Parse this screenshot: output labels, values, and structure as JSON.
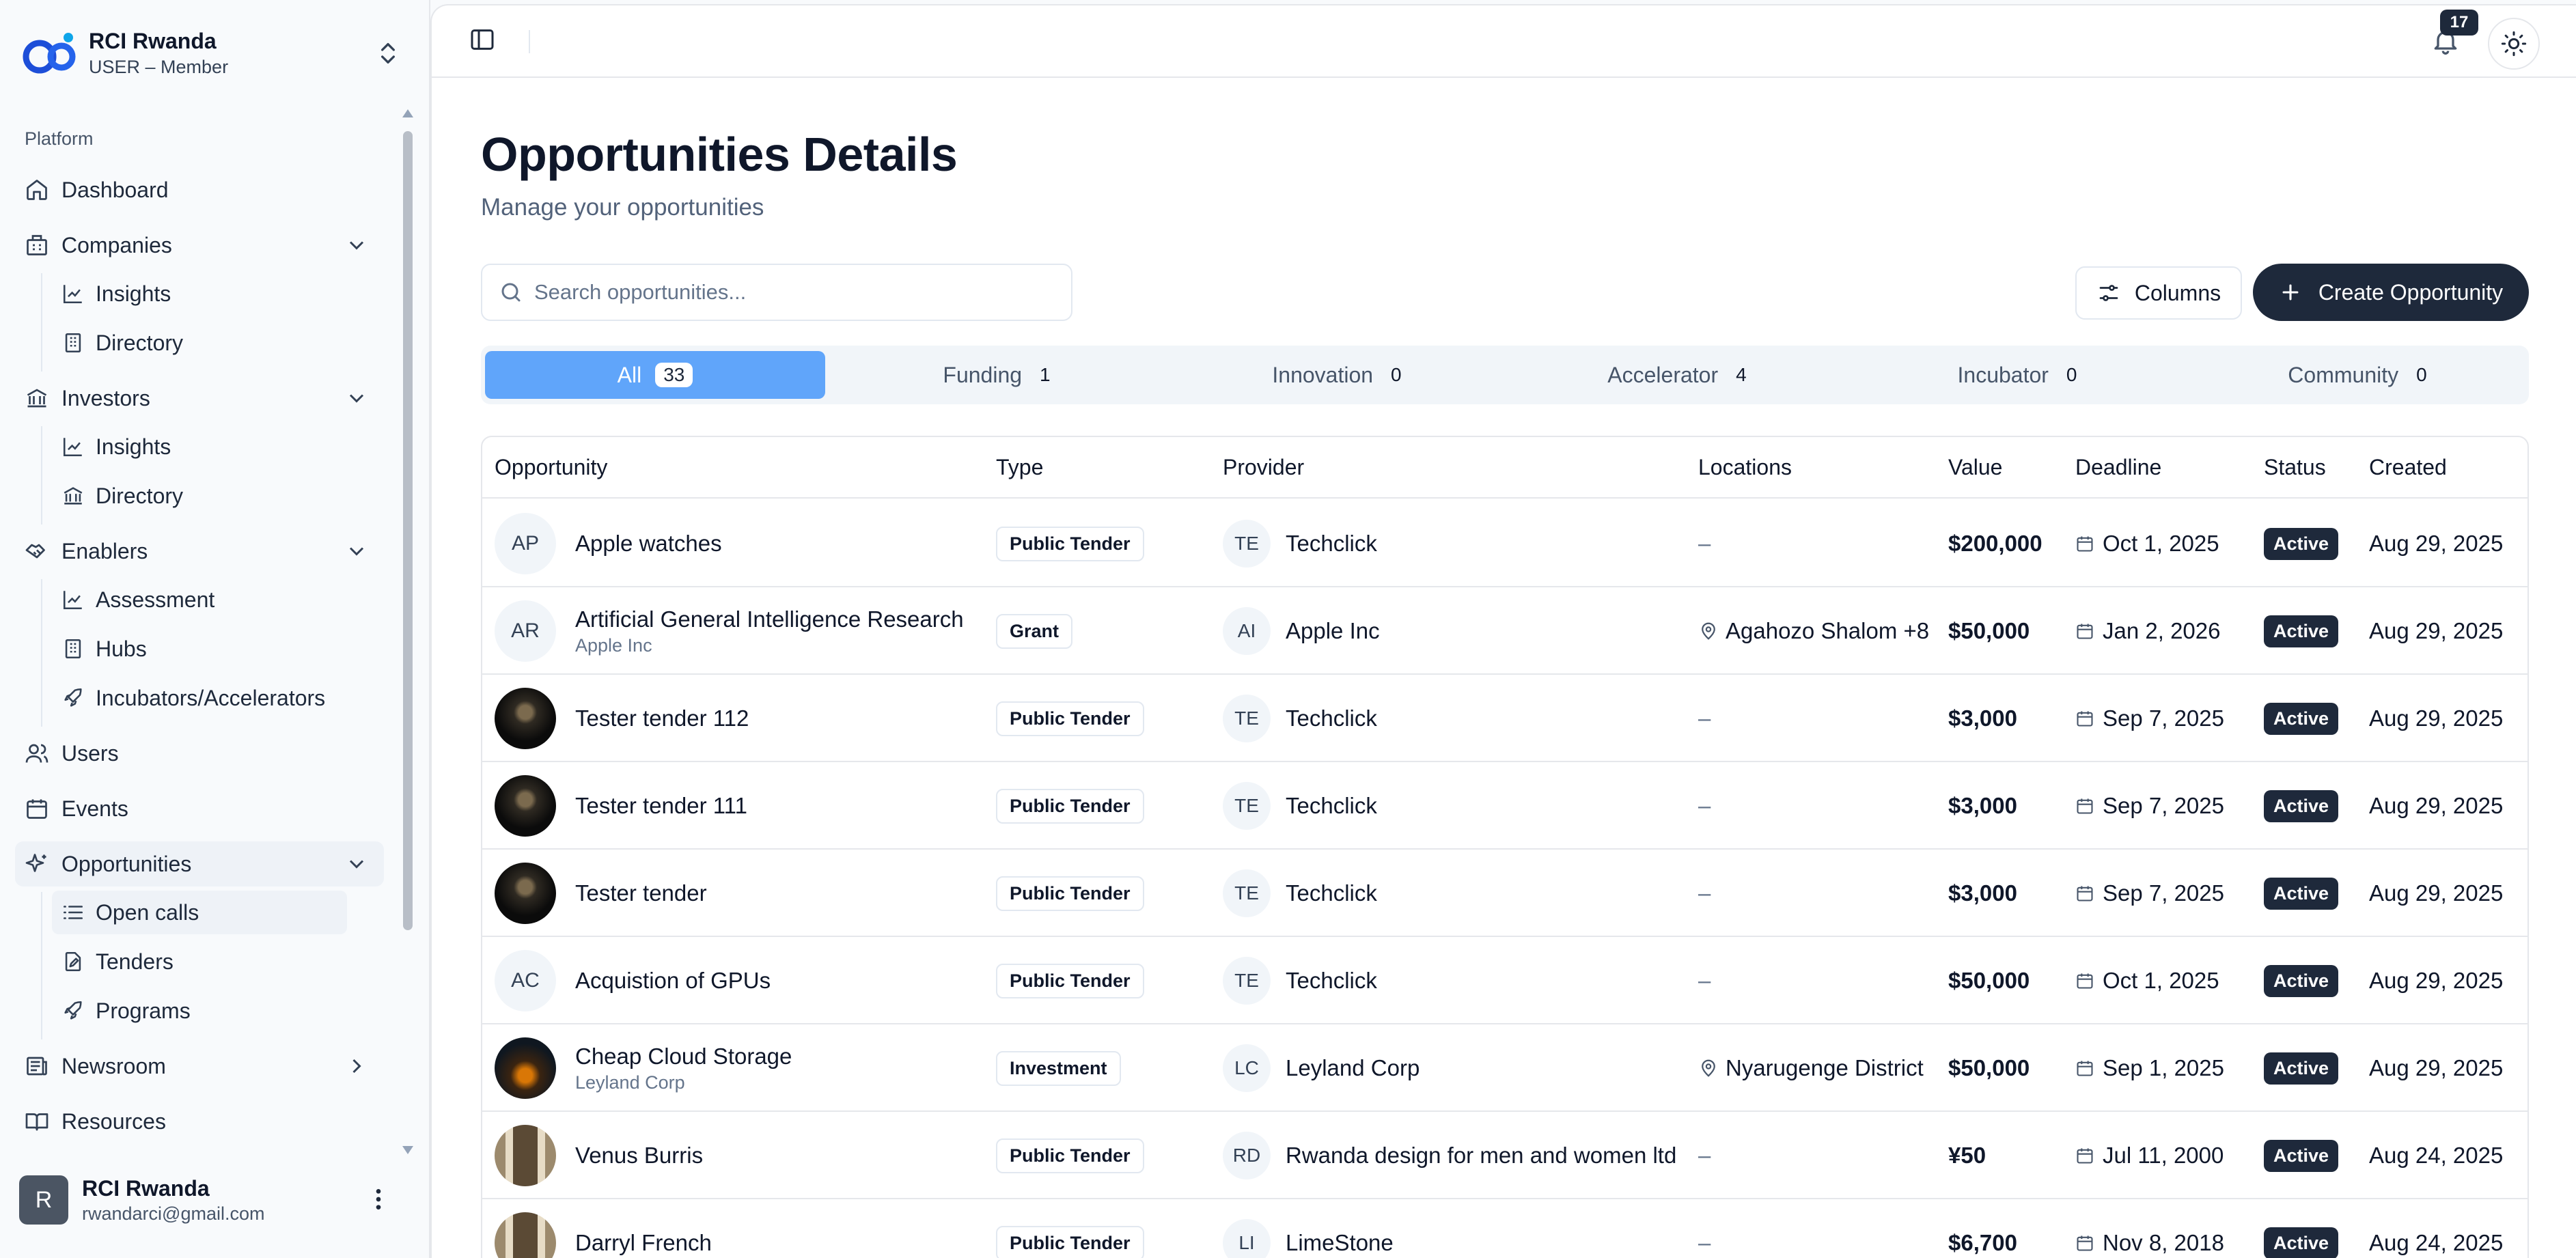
{
  "org": {
    "name": "RCI Rwanda",
    "role": "USER – Member"
  },
  "sidebar": {
    "section_label": "Platform",
    "dashboard": "Dashboard",
    "companies": {
      "label": "Companies",
      "insights": "Insights",
      "directory": "Directory"
    },
    "investors": {
      "label": "Investors",
      "insights": "Insights",
      "directory": "Directory"
    },
    "enablers": {
      "label": "Enablers",
      "assessment": "Assessment",
      "hubs": "Hubs",
      "incubators": "Incubators/Accelerators"
    },
    "users": "Users",
    "events": "Events",
    "opportunities": {
      "label": "Opportunities",
      "open_calls": "Open calls",
      "tenders": "Tenders",
      "programs": "Programs"
    },
    "newsroom": "Newsroom",
    "resources": "Resources"
  },
  "user": {
    "name": "RCI Rwanda",
    "email": "rwandarci@gmail.com",
    "avatar_initial": "R"
  },
  "topbar": {
    "notification_count": "17"
  },
  "page": {
    "title": "Opportunities Details",
    "subtitle": "Manage your opportunities"
  },
  "search": {
    "placeholder": "Search opportunities..."
  },
  "actions": {
    "columns": "Columns",
    "create": "Create Opportunity"
  },
  "tabs": [
    {
      "label": "All",
      "count": "33"
    },
    {
      "label": "Funding",
      "count": "1"
    },
    {
      "label": "Innovation",
      "count": "0"
    },
    {
      "label": "Accelerator",
      "count": "4"
    },
    {
      "label": "Incubator",
      "count": "0"
    },
    {
      "label": "Community",
      "count": "0"
    }
  ],
  "table": {
    "headers": {
      "opportunity": "Opportunity",
      "type": "Type",
      "provider": "Provider",
      "locations": "Locations",
      "value": "Value",
      "deadline": "Deadline",
      "status": "Status",
      "created": "Created"
    },
    "rows": [
      {
        "initials": "AP",
        "name": "Apple watches",
        "sub": "",
        "type": "Public Tender",
        "prov_initials": "TE",
        "provider": "Techclick",
        "location": "–",
        "value": "$200,000",
        "deadline": "Oct 1, 2025",
        "status": "Active",
        "created": "Aug 29, 2025"
      },
      {
        "initials": "AR",
        "name": "Artificial General Intelligence Research",
        "sub": "Apple Inc",
        "type": "Grant",
        "prov_initials": "AI",
        "provider": "Apple Inc",
        "location": "Agahozo Shalom +8",
        "value": "$50,000",
        "deadline": "Jan 2, 2026",
        "status": "Active",
        "created": "Aug 29, 2025"
      },
      {
        "initials": "",
        "name": "Tester tender 112",
        "sub": "",
        "type": "Public Tender",
        "prov_initials": "TE",
        "provider": "Techclick",
        "location": "–",
        "value": "$3,000",
        "deadline": "Sep 7, 2025",
        "status": "Active",
        "created": "Aug 29, 2025"
      },
      {
        "initials": "",
        "name": "Tester tender 111",
        "sub": "",
        "type": "Public Tender",
        "prov_initials": "TE",
        "provider": "Techclick",
        "location": "–",
        "value": "$3,000",
        "deadline": "Sep 7, 2025",
        "status": "Active",
        "created": "Aug 29, 2025"
      },
      {
        "initials": "",
        "name": "Tester tender",
        "sub": "",
        "type": "Public Tender",
        "prov_initials": "TE",
        "provider": "Techclick",
        "location": "–",
        "value": "$3,000",
        "deadline": "Sep 7, 2025",
        "status": "Active",
        "created": "Aug 29, 2025"
      },
      {
        "initials": "AC",
        "name": "Acquistion of GPUs",
        "sub": "",
        "type": "Public Tender",
        "prov_initials": "TE",
        "provider": "Techclick",
        "location": "–",
        "value": "$50,000",
        "deadline": "Oct 1, 2025",
        "status": "Active",
        "created": "Aug 29, 2025"
      },
      {
        "initials": "",
        "name": "Cheap Cloud Storage",
        "sub": "Leyland Corp",
        "type": "Investment",
        "prov_initials": "LC",
        "provider": "Leyland Corp",
        "location": "Nyarugenge District",
        "value": "$50,000",
        "deadline": "Sep 1, 2025",
        "status": "Active",
        "created": "Aug 29, 2025"
      },
      {
        "initials": "",
        "name": "Venus Burris",
        "sub": "",
        "type": "Public Tender",
        "prov_initials": "RD",
        "provider": "Rwanda design for men and women ltd",
        "location": "–",
        "value": "¥50",
        "deadline": "Jul 11, 2000",
        "status": "Active",
        "created": "Aug 24, 2025"
      },
      {
        "initials": "",
        "name": "Darryl French",
        "sub": "",
        "type": "Public Tender",
        "prov_initials": "LI",
        "provider": "LimeStone",
        "location": "–",
        "value": "$6,700",
        "deadline": "Nov 8, 2018",
        "status": "Active",
        "created": "Aug 24, 2025"
      }
    ]
  }
}
